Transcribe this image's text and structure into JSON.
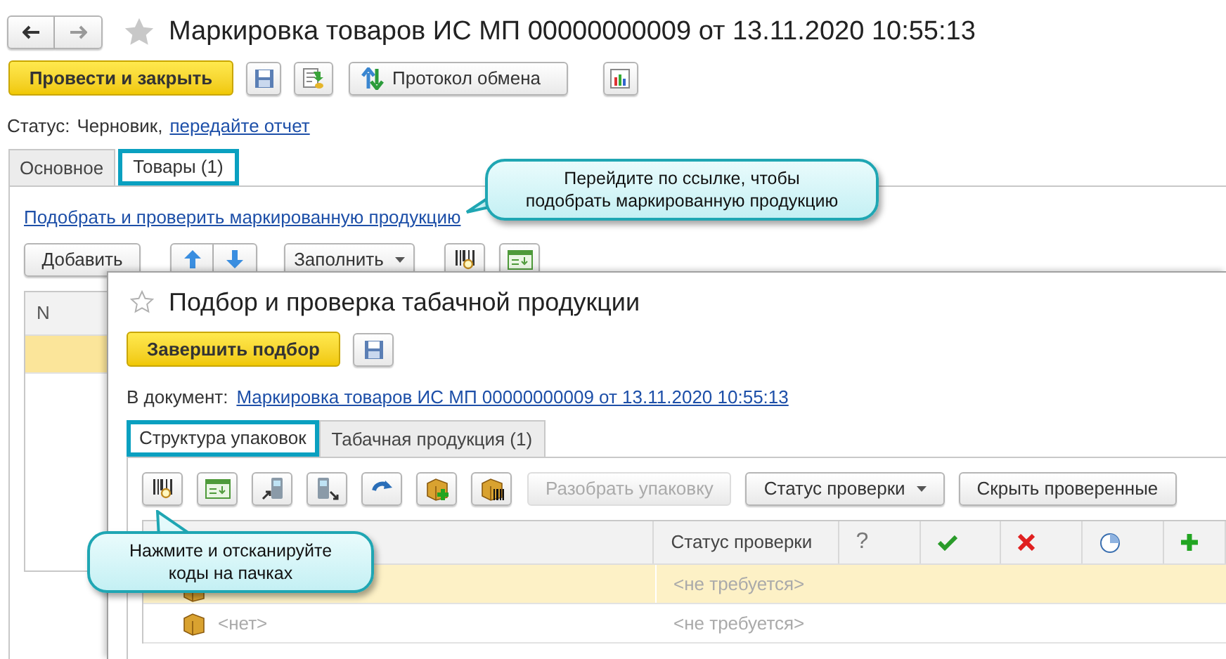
{
  "window": {
    "title": "Маркировка товаров ИС МП 00000000009 от 13.11.2020 10:55:13"
  },
  "toolbar": {
    "primary_button": "Провести и закрыть",
    "exchange_button": "Протокол обмена"
  },
  "status": {
    "label": "Статус:",
    "value": "Черновик,",
    "link": "передайте отчет"
  },
  "tabs": [
    {
      "label": "Основное",
      "selected": false
    },
    {
      "label": "Товары (1)",
      "selected": true
    }
  ],
  "pick_link": "Подобрать и проверить маркированную продукцию",
  "list_toolbar": {
    "add_button": "Добавить",
    "fill_button": "Заполнить"
  },
  "table": {
    "columns": [
      "N"
    ],
    "rows": [
      {
        "selected": true
      }
    ]
  },
  "dialog": {
    "title": "Подбор и проверка табачной продукции",
    "finish_button": "Завершить подбор",
    "document_label": "В документ:",
    "document_link": "Маркировка товаров ИС МП 00000000009 от 13.11.2020 10:55:13",
    "tabs": [
      {
        "label": "Структура упаковок",
        "selected": true
      },
      {
        "label": "Табачная продукция (1)",
        "selected": false
      }
    ],
    "buttons": [
      {
        "label": "Разобрать упаковку",
        "disabled": true,
        "dropdown": false
      },
      {
        "label": "Статус проверки",
        "disabled": false,
        "dropdown": true
      },
      {
        "label": "Скрыть проверенные",
        "disabled": false,
        "dropdown": false
      }
    ],
    "columns": [
      {
        "kind": "text",
        "label": "Статус проверки"
      },
      {
        "kind": "text",
        "label": "?"
      },
      {
        "kind": "check"
      },
      {
        "kind": "cross"
      },
      {
        "kind": "clock"
      },
      {
        "kind": "plus"
      }
    ],
    "rows": [
      {
        "selected": true,
        "status": "<не требуется>"
      },
      {
        "selected": false,
        "name": "<нет>",
        "status": "<не требуется>"
      }
    ]
  },
  "callouts": [
    {
      "lines": [
        "Перейдите по ссылке, чтобы",
        "подобрать маркированную продукцию"
      ]
    },
    {
      "lines": [
        "Нажмите и отсканируйте",
        "коды на пачках"
      ]
    }
  ]
}
